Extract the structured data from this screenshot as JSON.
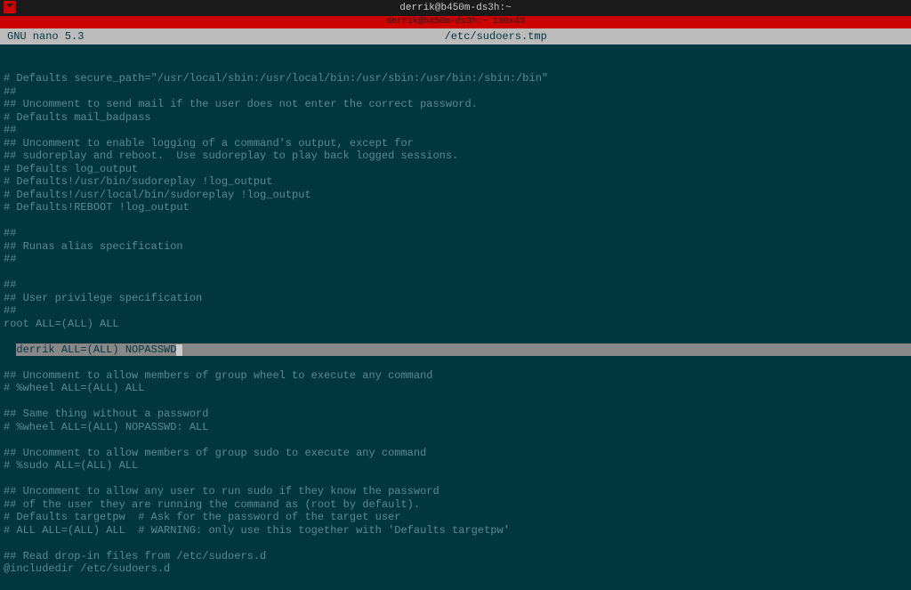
{
  "titlebar": {
    "title": "derrik@b450m-ds3h:~"
  },
  "redbar": {
    "text": "derrik@b450m-ds3h:~ 190x43"
  },
  "statusbar": {
    "app": "GNU nano 5.3",
    "filename": "/etc/sudoers.tmp"
  },
  "editor": {
    "lines": [
      "# Defaults secure_path=\"/usr/local/sbin:/usr/local/bin:/usr/sbin:/usr/bin:/sbin:/bin\"",
      "##",
      "## Uncomment to send mail if the user does not enter the correct password.",
      "# Defaults mail_badpass",
      "##",
      "## Uncomment to enable logging of a command's output, except for",
      "## sudoreplay and reboot.  Use sudoreplay to play back logged sessions.",
      "# Defaults log_output",
      "# Defaults!/usr/bin/sudoreplay !log_output",
      "# Defaults!/usr/local/bin/sudoreplay !log_output",
      "# Defaults!REBOOT !log_output",
      "",
      "##",
      "## Runas alias specification",
      "##",
      "",
      "##",
      "## User privilege specification",
      "##",
      "root ALL=(ALL) ALL"
    ],
    "highlighted": "derrik ALL=(ALL) NOPASSWD",
    "lines_after": [
      "## Uncomment to allow members of group wheel to execute any command",
      "# %wheel ALL=(ALL) ALL",
      "",
      "## Same thing without a password",
      "# %wheel ALL=(ALL) NOPASSWD: ALL",
      "",
      "## Uncomment to allow members of group sudo to execute any command",
      "# %sudo ALL=(ALL) ALL",
      "",
      "## Uncomment to allow any user to run sudo if they know the password",
      "## of the user they are running the command as (root by default).",
      "# Defaults targetpw  # Ask for the password of the target user",
      "# ALL ALL=(ALL) ALL  # WARNING: only use this together with 'Defaults targetpw'",
      "",
      "## Read drop-in files from /etc/sudoers.d",
      "@includedir /etc/sudoers.d"
    ]
  }
}
